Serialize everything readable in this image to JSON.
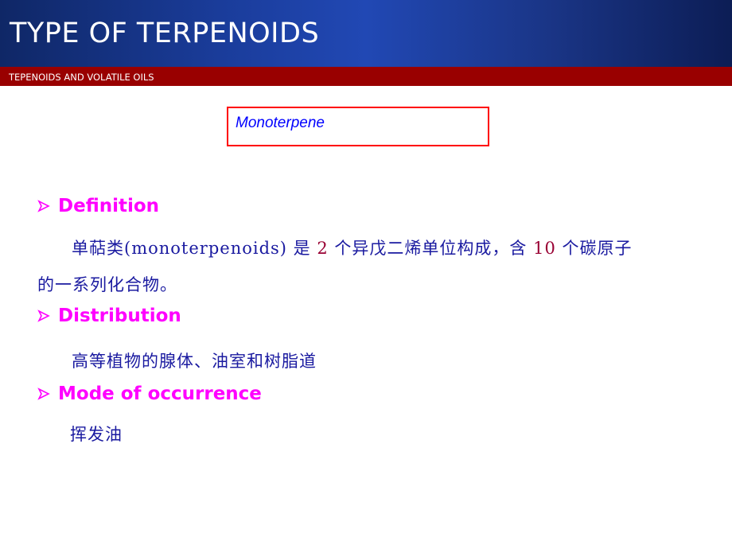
{
  "header": {
    "title": "TYPE OF TERPENOIDS",
    "subtitle": "TEPENOIDS AND VOLATILE OILS"
  },
  "topic_box": {
    "label": "Monoterpene"
  },
  "colors": {
    "header_blue": "#1a3c9a",
    "subtitle_red": "#990000",
    "box_border": "#ff0000",
    "topic_text": "#0000ff",
    "heading_magenta": "#ff00ff",
    "body_blue": "#1a1aa0",
    "number_red": "#990033"
  },
  "sections": [
    {
      "heading": "Definition",
      "bullet_icon": "arrow-right-bullet",
      "lines": [
        {
          "part1": "单萜类(monoterpenoids) 是 ",
          "num1": "2",
          "part2": " 个异戊二烯单位构成，含 ",
          "num2": "10",
          "part3": " 个碳原子"
        },
        {
          "text": "的一系列化合物。"
        }
      ]
    },
    {
      "heading": "Distribution",
      "bullet_icon": "arrow-right-bullet",
      "lines": [
        {
          "text": "高等植物的腺体、油室和树脂道"
        }
      ]
    },
    {
      "heading": "Mode of occurrence",
      "bullet_icon": "arrow-right-bullet",
      "lines": [
        {
          "text": "挥发油"
        }
      ]
    }
  ]
}
